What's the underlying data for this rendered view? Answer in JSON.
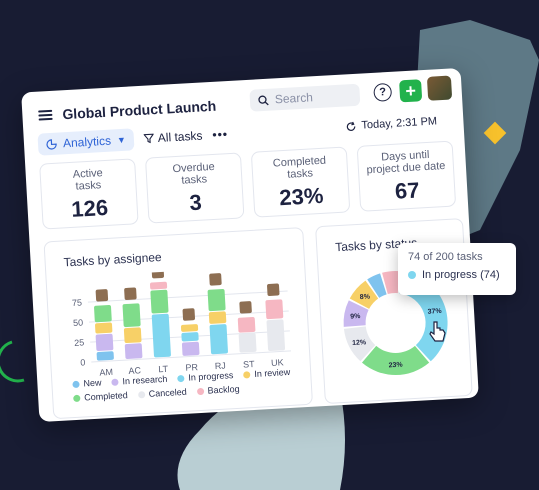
{
  "header": {
    "title": "Global Product Launch",
    "search_placeholder": "Search",
    "help_label": "?",
    "add_label": "+"
  },
  "toolbar": {
    "analytics_label": "Analytics",
    "all_tasks_label": "All tasks",
    "more_label": "•••",
    "updated_label": "Today, 2:31 PM"
  },
  "stats": [
    {
      "label": "Active tasks",
      "value": "126"
    },
    {
      "label": "Overdue tasks",
      "value": "3"
    },
    {
      "label": "Completed tasks",
      "value": "23%"
    },
    {
      "label": "Days until project due date",
      "value": "67"
    }
  ],
  "assignee_panel": {
    "title": "Tasks by assignee"
  },
  "status_panel": {
    "title": "Tasks by status"
  },
  "tooltip": {
    "line1": "74 of 200 tasks",
    "line2": "In progress (74)"
  },
  "colors": {
    "New": "#7fc3ee",
    "In research": "#c9b8ef",
    "In progress": "#7fd6ef",
    "In review": "#f7d067",
    "Completed": "#7fdc8a",
    "Canceled": "#e7e9ee",
    "Backlog": "#f6b7c2"
  },
  "legend": [
    "New",
    "In research",
    "In progress",
    "In review",
    "Completed",
    "Canceled",
    "Backlog"
  ],
  "chart_data": [
    {
      "type": "bar",
      "title": "Tasks by assignee",
      "categories": [
        "AM",
        "AC",
        "LT",
        "PR",
        "RJ",
        "ST",
        "UK"
      ],
      "yticks": [
        0,
        25,
        50,
        75
      ],
      "ylim": [
        0,
        100
      ],
      "stacked": true,
      "series": [
        {
          "name": "New",
          "values": [
            12,
            0,
            0,
            0,
            0,
            0,
            0
          ]
        },
        {
          "name": "In research",
          "values": [
            22,
            20,
            0,
            18,
            0,
            0,
            0
          ]
        },
        {
          "name": "In progress",
          "values": [
            0,
            0,
            55,
            12,
            38,
            0,
            0
          ]
        },
        {
          "name": "In review",
          "values": [
            14,
            20,
            0,
            10,
            16,
            0,
            0
          ]
        },
        {
          "name": "Completed",
          "values": [
            22,
            30,
            30,
            0,
            28,
            0,
            0
          ]
        },
        {
          "name": "Canceled",
          "values": [
            0,
            0,
            0,
            0,
            0,
            25,
            40
          ]
        },
        {
          "name": "Backlog",
          "values": [
            0,
            0,
            10,
            0,
            0,
            20,
            25
          ]
        }
      ]
    },
    {
      "type": "pie",
      "title": "Tasks by status",
      "categories": [
        "In progress",
        "Completed",
        "Canceled",
        "In research",
        "In review",
        "New",
        "Backlog"
      ],
      "values": [
        37,
        23,
        12,
        9,
        8,
        5,
        6
      ],
      "labels": [
        "37%",
        "23%",
        "12%",
        "9%",
        "8%",
        "",
        ""
      ]
    }
  ]
}
